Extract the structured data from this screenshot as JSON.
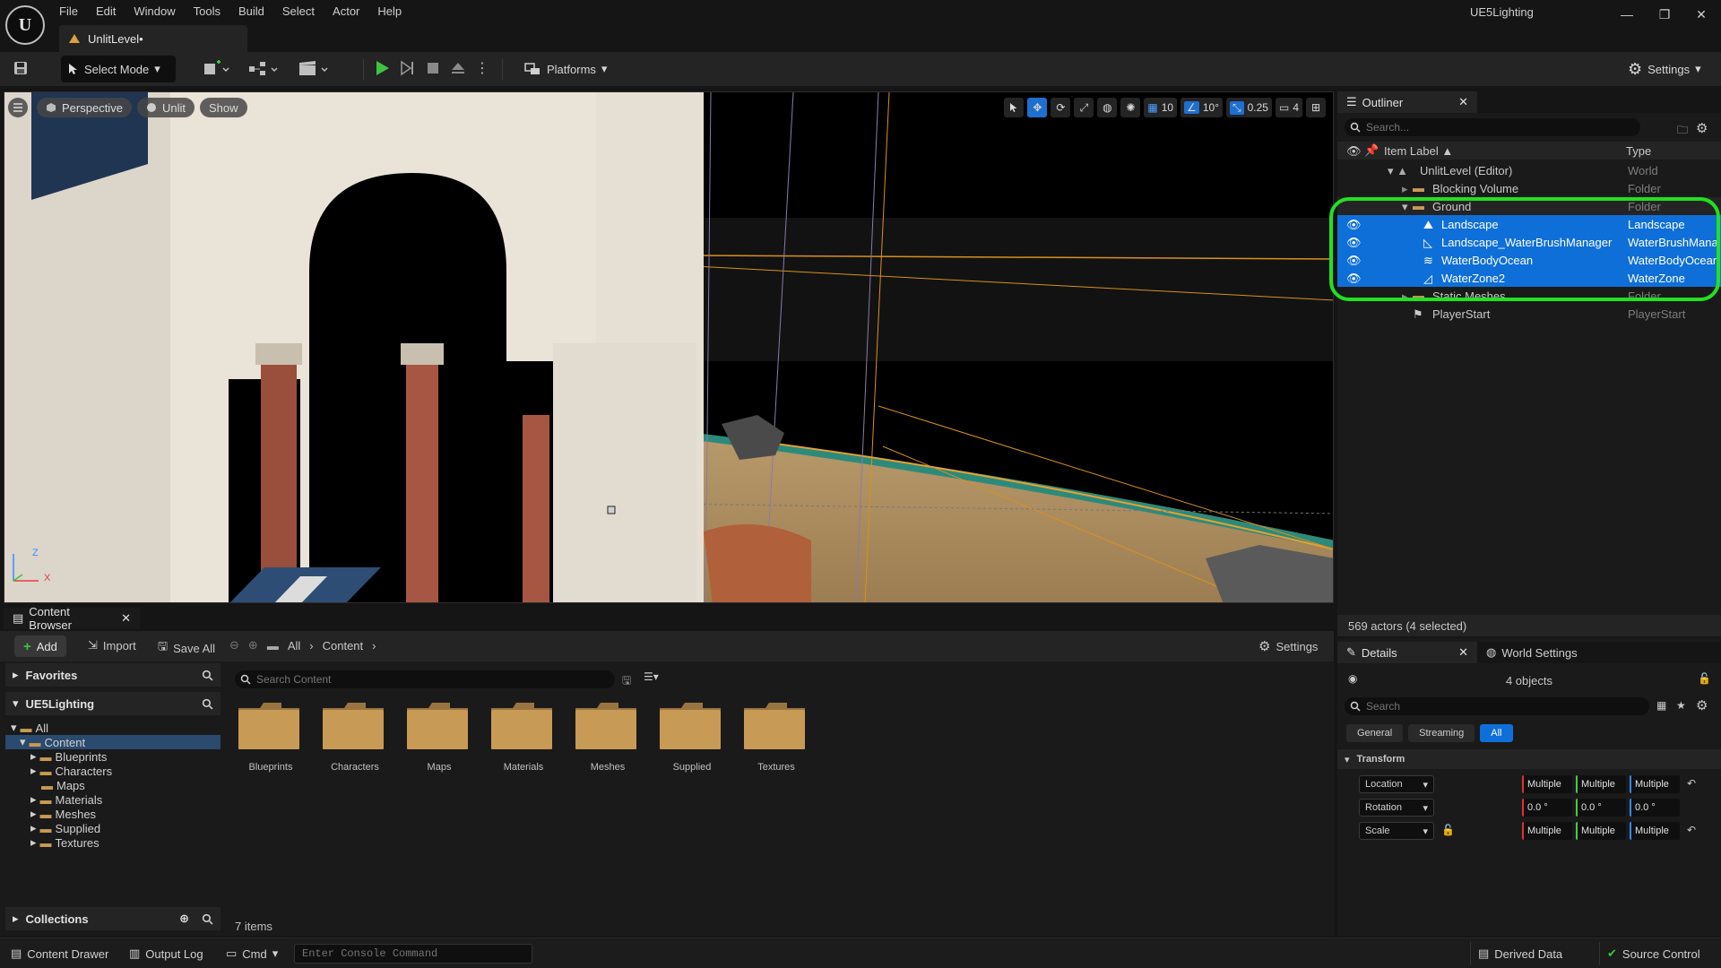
{
  "app": {
    "logo_text": "U",
    "project_name": "UE5Lighting",
    "document_tab": "UnlitLevel•",
    "menu": [
      "File",
      "Edit",
      "Window",
      "Tools",
      "Build",
      "Select",
      "Actor",
      "Help"
    ],
    "window_controls": [
      "—",
      "❐",
      "✕"
    ]
  },
  "toolbar": {
    "select_mode": "Select Mode",
    "platforms": "Platforms",
    "settings": "Settings"
  },
  "viewport": {
    "perspective": "Perspective",
    "view_mode": "Unlit",
    "show": "Show",
    "grid_snap": "10",
    "rotation_snap": "10°",
    "scale_snap": "0.25",
    "camera_speed": "4",
    "axis_z": "Z",
    "axis_x": "X"
  },
  "outliner": {
    "tab_title": "Outliner",
    "search_placeholder": "Search...",
    "col_label": "Item Label ▲",
    "col_type": "Type",
    "rows": [
      {
        "label": "UnlitLevel (Editor)",
        "type": "World",
        "selected": false
      },
      {
        "label": "Blocking Volume",
        "type": "Folder",
        "selected": false
      },
      {
        "label": "Ground",
        "type": "Folder",
        "selected": false
      },
      {
        "label": "Landscape",
        "type": "Landscape",
        "selected": true
      },
      {
        "label": "Landscape_WaterBrushManager",
        "type": "WaterBrushMana",
        "selected": true
      },
      {
        "label": "WaterBodyOcean",
        "type": "WaterBodyOcean",
        "selected": true
      },
      {
        "label": "WaterZone2",
        "type": "WaterZone",
        "selected": true
      },
      {
        "label": "Static Meshes",
        "type": "Folder",
        "selected": false
      },
      {
        "label": "PlayerStart",
        "type": "PlayerStart",
        "selected": false
      }
    ],
    "status": "569 actors (4 selected)"
  },
  "content_browser": {
    "tab_title": "Content Browser",
    "add": "Add",
    "import": "Import",
    "save_all": "Save All",
    "path": [
      "All",
      "Content"
    ],
    "settings": "Settings",
    "favorites": "Favorites",
    "project": "UE5Lighting",
    "collections": "Collections",
    "search_placeholder": "Search Content",
    "tree": [
      {
        "label": "All",
        "open": true
      },
      {
        "label": "Content",
        "open": true
      },
      {
        "label": "Blueprints",
        "open": false
      },
      {
        "label": "Characters",
        "open": false
      },
      {
        "label": "Maps",
        "open": false
      },
      {
        "label": "Materials",
        "open": false
      },
      {
        "label": "Meshes",
        "open": false
      },
      {
        "label": "Supplied",
        "open": false
      },
      {
        "label": "Textures",
        "open": false
      }
    ],
    "folders": [
      "Blueprints",
      "Characters",
      "Maps",
      "Materials",
      "Meshes",
      "Supplied",
      "Textures"
    ],
    "item_count": "7 items"
  },
  "details": {
    "tab_title": "Details",
    "world_settings": "World Settings",
    "object_count": "4 objects",
    "search_placeholder": "Search",
    "filters": [
      "General",
      "Streaming",
      "All"
    ],
    "section": "Transform",
    "rows": [
      {
        "label": "Location",
        "values": [
          "Multiple",
          "Multiple",
          "Multiple"
        ]
      },
      {
        "label": "Rotation",
        "values": [
          "0.0 °",
          "0.0 °",
          "0.0 °"
        ]
      },
      {
        "label": "Scale",
        "values": [
          "Multiple",
          "Multiple",
          "Multiple"
        ]
      }
    ]
  },
  "statusbar": {
    "content_drawer": "Content Drawer",
    "output_log": "Output Log",
    "cmd": "Cmd",
    "console_placeholder": "Enter Console Command",
    "derived_data": "Derived Data",
    "source_control": "Source Control"
  },
  "colors": {
    "selection": "#0f6fd8",
    "highlight_ring": "#22e022",
    "play_green": "#3fc43f",
    "folder": "#c79a55"
  }
}
